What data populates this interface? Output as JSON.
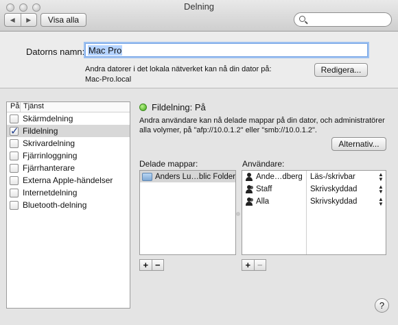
{
  "window": {
    "title": "Delning"
  },
  "toolbar": {
    "back_glyph": "◀",
    "forward_glyph": "▶",
    "show_all_label": "Visa alla",
    "search_placeholder": ""
  },
  "computer_name": {
    "label": "Datorns namn:",
    "value": "Mac Pro",
    "description_line1": "Andra datorer i det lokala nätverket kan nå din dator på:",
    "description_line2": "Mac-Pro.local",
    "edit_button": "Redigera..."
  },
  "services": {
    "header_on": "På",
    "header_service": "Tjänst",
    "items": [
      {
        "label": "Skärmdelning",
        "checked": false
      },
      {
        "label": "Fildelning",
        "checked": true
      },
      {
        "label": "Skrivardelning",
        "checked": false
      },
      {
        "label": "Fjärrinloggning",
        "checked": false
      },
      {
        "label": "Fjärrhanterare",
        "checked": false
      },
      {
        "label": "Externa Apple-händelser",
        "checked": false
      },
      {
        "label": "Internetdelning",
        "checked": false
      },
      {
        "label": "Bluetooth-delning",
        "checked": false
      }
    ]
  },
  "status": {
    "title": "Fildelning: På",
    "color": "#3fa718",
    "description": "Andra användare kan nå delade mappar på din dator, och administratörer alla volymer, på \"afp://10.0.1.2\" eller \"smb://10.0.1.2\".",
    "options_button": "Alternativ..."
  },
  "shared_folders": {
    "label": "Delade mappar:",
    "items": [
      {
        "name": "Anders Lu…blic Folder",
        "icon": "folder-icon"
      }
    ],
    "add_label": "+",
    "remove_label": "−"
  },
  "users": {
    "label": "Användare:",
    "items": [
      {
        "name": "Ande…dberg",
        "permission": "Läs-/skrivbar",
        "icon": "user-icon"
      },
      {
        "name": "Staff",
        "permission": "Skrivskyddad",
        "icon": "group-icon"
      },
      {
        "name": "Alla",
        "permission": "Skrivskyddad",
        "icon": "group-icon"
      }
    ],
    "stepper_glyph_up": "▲",
    "stepper_glyph_down": "▼",
    "add_label": "+",
    "remove_label": "−"
  },
  "help": {
    "label": "?"
  }
}
